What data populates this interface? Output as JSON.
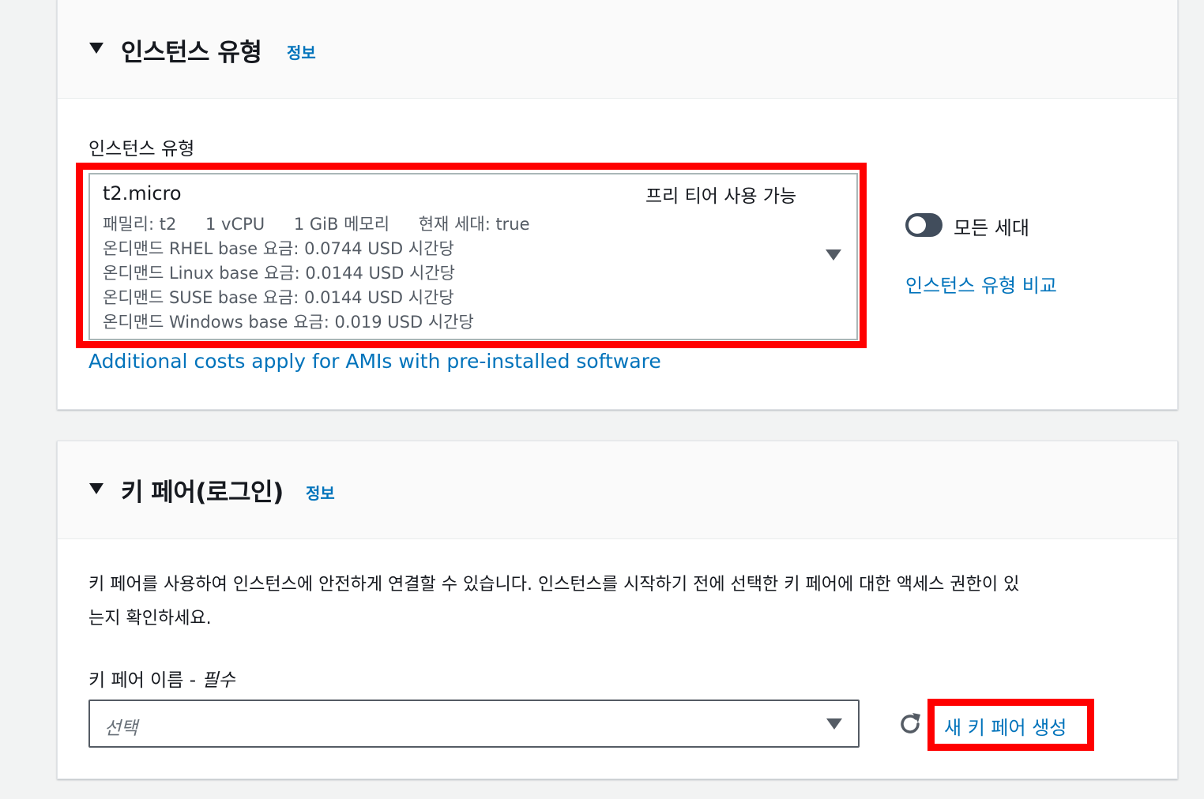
{
  "instance_section": {
    "title": "인스턴스 유형",
    "info": "정보",
    "field_label": "인스턴스 유형",
    "selected": {
      "name": "t2.micro",
      "tag": "프리 티어 사용 가능",
      "specs": [
        "패밀리: t2",
        "1 vCPU",
        "1 GiB 메모리",
        "현재 세대: true"
      ],
      "prices": [
        "온디맨드 RHEL base 요금: 0.0744 USD 시간당",
        "온디맨드 Linux base 요금: 0.0144 USD 시간당",
        "온디맨드 SUSE base 요금: 0.0144 USD 시간당",
        "온디맨드 Windows base 요금: 0.019 USD 시간당"
      ]
    },
    "all_generations_label": "모든 세대",
    "all_generations_on": false,
    "compare_link": "인스턴스 유형 비교",
    "additional_costs_link": "Additional costs apply for AMIs with pre-installed software"
  },
  "keypair_section": {
    "title": "키 페어(로그인)",
    "info": "정보",
    "description_line1": "키 페어를 사용하여 인스턴스에 안전하게 연결할 수 있습니다. 인스턴스를 시작하기 전에 선택한 키 페어에 대한 액세스 권한이 있",
    "description_line2": "는지 확인하세요.",
    "name_label": "키 페어 이름 - ",
    "name_required": "필수",
    "select_placeholder": "선택",
    "create_button": "새 키 페어 생성"
  },
  "colors": {
    "link": "#0073bb",
    "highlight": "#ff0000",
    "toggle_off": "#414d5c"
  },
  "icons": [
    "caret-down-icon",
    "dropdown-arrow-icon",
    "refresh-icon"
  ]
}
